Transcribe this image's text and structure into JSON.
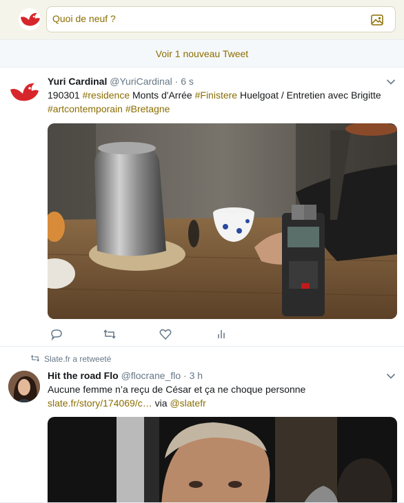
{
  "compose": {
    "placeholder": "Quoi de neuf ?",
    "avatar_icon": "bird-logo-icon",
    "media_icon": "image-icon"
  },
  "banner": {
    "new_tweets_label": "Voir 1 nouveau Tweet"
  },
  "tweets": [
    {
      "name": "Yuri Cardinal",
      "handle": "@YuriCardinal",
      "separator": "·",
      "time": "6 s",
      "text_parts": [
        "190301 ",
        "#residence",
        " Monts d'Arrée ",
        "#Finistere",
        " Huelgoat / Entretien avec Brigitte ",
        "#artcontemporain",
        " ",
        "#Bretagne"
      ],
      "actions": [
        "reply-icon",
        "retweet-icon",
        "like-icon",
        "analytics-icon"
      ]
    },
    {
      "retweet_context": "Slate.fr a retweeté",
      "name": "Hit the road Flo",
      "handle": "@flocrane_flo",
      "separator": "·",
      "time": "3 h",
      "line1": "Aucune femme n’a reçu de César et ça ne choque personne",
      "link": "slate.fr/story/174069/c…",
      "via_word": " via ",
      "via_handle": "@slatefr"
    }
  ],
  "colors": {
    "accent": "#8a6d00",
    "brand_red": "#d7262b",
    "compose_bg": "#f5f4ea",
    "muted": "#657786"
  }
}
